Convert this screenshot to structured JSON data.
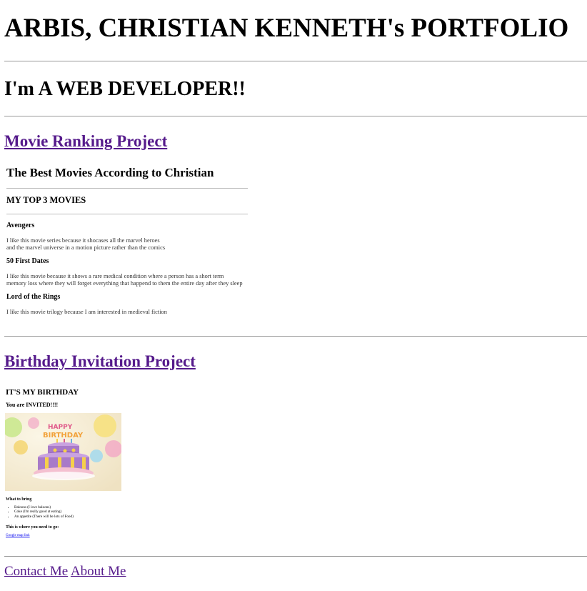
{
  "header": {
    "title": "ARBIS, CHRISTIAN KENNETH's PORTFOLIO",
    "subtitle": "I'm A WEB DEVELOPER!!"
  },
  "projects": {
    "movie": {
      "link": "Movie Ranking Project",
      "heading": "The Best Movies According to Christian",
      "subheading": "MY TOP 3 MOVIES",
      "movies": [
        {
          "title": "Avengers",
          "lines": [
            "I like this movie series because it shocases all the marvel heroes",
            "and the marvel universe in a motion picture rather than the comics"
          ]
        },
        {
          "title": "50 First Dates",
          "lines": [
            "I like this movie because it shows a rare medical condition where a person has a short term",
            "memory loss where they will forget everything that happend to them the entire day after they sleep"
          ]
        },
        {
          "title": "Lord of the Rings",
          "lines": [
            "I like this movie trilogy because I am interested in medieval fiction"
          ]
        }
      ]
    },
    "birthday": {
      "link": "Birthday Invitation Project",
      "heading": "IT'S MY BIRTHDAY",
      "subheading": "You are INVITED!!!!",
      "bring_heading": "What to bring",
      "bring_items": [
        "Baloons (I love baloons)",
        "Coke (I'm really good at eating)",
        "An appetite (There will be lots of Food)"
      ],
      "where_heading": "This is where you need to go:",
      "map_link": "Google map link",
      "colors": {
        "bg": "#f3ecd8",
        "cake": "#a87ac8",
        "frosting": "#f4c0d0"
      }
    }
  },
  "footer": {
    "contact": "Contact Me",
    "about": "About Me"
  }
}
